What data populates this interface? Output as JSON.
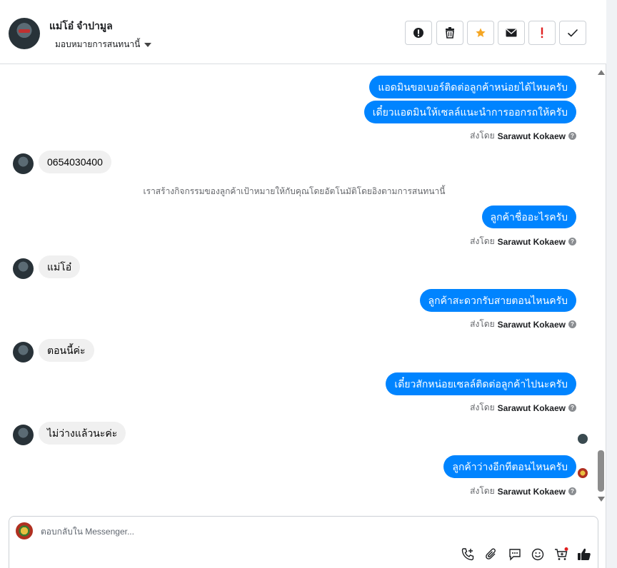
{
  "header": {
    "contact_name": "แม่โอ๋ จำปามูล",
    "assign_label": "มอบหมายการสนทนานี้",
    "actions": [
      "report-icon",
      "trash-icon",
      "star-icon",
      "mail-icon",
      "exclamation-icon",
      "check-icon"
    ]
  },
  "colors": {
    "accent": "#0084ff",
    "star": "#f5a623",
    "alert": "#e02020",
    "incoming_bg": "#f0f0f0"
  },
  "thread": {
    "out1a": "แอดมินขอเบอร์ติดต่อลูกค้าหน่อยได้ไหมครับ",
    "out1b": "เดี๋ยวแอดมินให้เซลล์แนะนำการออกรถให้ครับ",
    "in1": "0654030400",
    "system_note": "เราสร้างกิจกรรมของลูกค้าเป้าหมายให้กับคุณโดยอัตโนมัติโดยอิงตามการสนทนานี้",
    "out2": "ลูกค้าชื่ออะไรครับ",
    "in2": "แม่โอ๋",
    "out3": "ลูกค้าสะดวกรับสายตอนไหนครับ",
    "in3": "ตอนนี้ค่ะ",
    "out4": "เดี๋ยวสักหน่อยเซลล์ติดต่อลูกค้าไปนะครับ",
    "in4": "ไม่ว่างแล้วนะค่ะ",
    "out5": "ลูกค้าว่างอีกทีตอนไหนครับ",
    "sent_by_prefix": "ส่งโดย",
    "sender": "Sarawut Kokaew",
    "help_glyph": "?"
  },
  "composer": {
    "placeholder": "ตอบกลับใน Messenger...",
    "value": "",
    "tools": [
      "call-add-icon",
      "attachment-icon",
      "saved-reply-icon",
      "emoji-icon",
      "cart-icon",
      "like-icon"
    ]
  }
}
